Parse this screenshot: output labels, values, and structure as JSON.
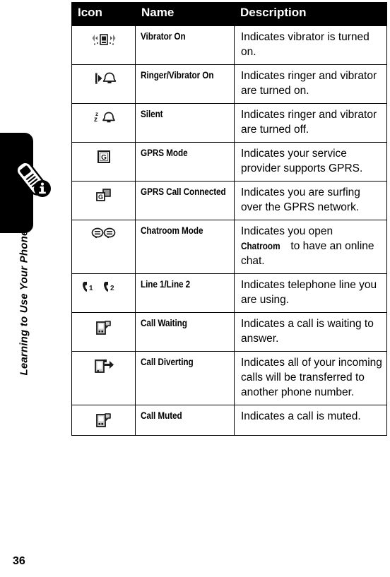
{
  "page": {
    "number": "36",
    "chapter_tab_label": "Learning to Use Your Phone",
    "tab_icon": "phone-info-icon"
  },
  "table": {
    "name": "status-indicators-table",
    "headers": [
      "Icon",
      "Name",
      "Description"
    ],
    "rows": [
      {
        "icon": "vibrator-on-icon",
        "name": "Vibrator On",
        "description": "Indicates vibrator is turned on."
      },
      {
        "icon": "ringer-vibrator-on-icon",
        "name": "Ringer/Vibrator On",
        "description": "Indicates ringer and vibrator are turned on."
      },
      {
        "icon": "silent-icon",
        "name": "Silent",
        "description": "Indicates ringer and vibrator are turned off."
      },
      {
        "icon": "gprs-mode-icon",
        "name": "GPRS Mode",
        "description": "Indicates your service provider supports GPRS."
      },
      {
        "icon": "gprs-call-connected-icon",
        "name": "GPRS Call Connected",
        "description": "Indicates you are surfing over the GPRS network."
      },
      {
        "icon": "chatroom-mode-icon",
        "name": "Chatroom Mode",
        "description_before": "Indicates you open ",
        "description_emphasis": "Chatroom",
        "description_after": " to have an online chat."
      },
      {
        "icon": "line1-line2-icon",
        "name": "Line 1/Line 2",
        "description": "Indicates telephone line you are using."
      },
      {
        "icon": "call-waiting-icon",
        "name": "Call Waiting",
        "description": "Indicates a call is waiting to answer."
      },
      {
        "icon": "call-diverting-icon",
        "name": "Call Diverting",
        "description": "Indicates all of your incoming calls will be transferred to another phone number."
      },
      {
        "icon": "call-muted-icon",
        "name": "Call Muted",
        "description": "Indicates a call is muted."
      }
    ]
  },
  "colors": {
    "header_background": "#000000",
    "header_text": "#ffffff",
    "border": "#000000",
    "body_text": "#000000",
    "tab_background": "#000000",
    "icon_grey": "#808080",
    "icon_dark": "#1a1a1a"
  }
}
